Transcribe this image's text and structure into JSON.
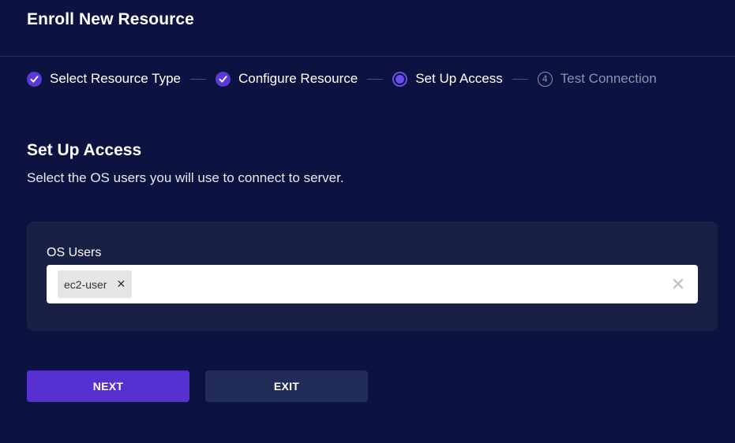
{
  "header": {
    "title": "Enroll New Resource"
  },
  "stepper": {
    "steps": [
      {
        "label": "Select Resource Type",
        "state": "done"
      },
      {
        "label": "Configure Resource",
        "state": "done"
      },
      {
        "label": "Set Up Access",
        "state": "active"
      },
      {
        "label": "Test Connection",
        "state": "pending",
        "number": "4"
      }
    ]
  },
  "section": {
    "title": "Set Up Access",
    "subtitle": "Select the OS users you will use to connect to server."
  },
  "os_users": {
    "label": "OS Users",
    "selected": [
      "ec2-user"
    ],
    "chip_remove_glyph": "✕"
  },
  "buttons": {
    "next": "NEXT",
    "exit": "EXIT"
  },
  "colors": {
    "background": "#0c1340",
    "card": "#182046",
    "accent": "#5630d0",
    "secondary_button": "#222c59",
    "muted_text": "#8d92b3"
  }
}
